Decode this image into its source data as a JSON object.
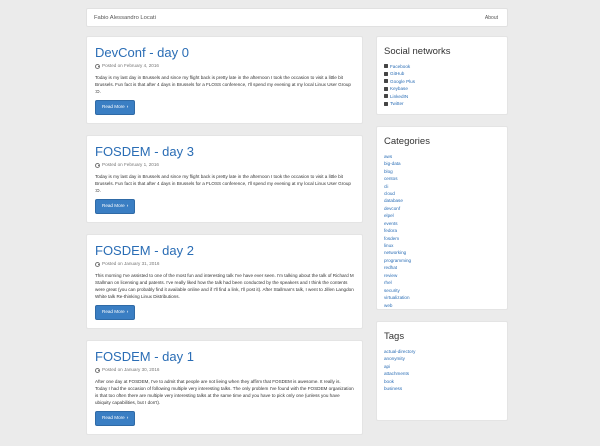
{
  "navbar": {
    "brand": "Fabio Alessandro Locati",
    "about": "About"
  },
  "posts": [
    {
      "title": "DevConf - day 0",
      "date": "Posted on February 4, 2016",
      "body": "Today is my last day in Brussels and since my flight back is pretty late in the afternoon I took the occasion to visit a little bit Brussels. Fun fact is that after 4 days in Brussels for a FLOSS conference, I'll spend my evening at my local Linux User Group :D.",
      "button": "Read More"
    },
    {
      "title": "FOSDEM - day 3",
      "date": "Posted on February 1, 2016",
      "body": "Today is my last day in Brussels and since my flight back is pretty late in the afternoon I took the occasion to visit a little bit Brussels. Fun fact is that after 4 days in Brussels for a FLOSS conference, I'll spend my evening at my local Linux User Group :D.",
      "button": "Read More"
    },
    {
      "title": "FOSDEM - day 2",
      "date": "Posted on January 31, 2016",
      "body": "This morning I've assisted to one of the most fun and interesting talk I've have ever seen. I'm talking about the talk of Richard M Stallman on licensing and patents. I've really liked how the talk had been conducted by the speakers and I think the contents were great (you can probably find it available online and if I'll find a link, I'll post it). After Stallman's talk, I went to Jillen Langdon White talk Re-thinking Linux Distributions.",
      "button": "Read More"
    },
    {
      "title": "FOSDEM - day 1",
      "date": "Posted on January 30, 2016",
      "body": "After one day at FOSDEM, I've to admit that people are not lieing when they affirm that FOSDEM is awesome. It really is. Today I had the occasion of following multiple very interesting talks. The only problem I've found with the FOSDEM organization is that too often there are multiple very interesting talks at the same time and you have to pick only one (unless you have ubiquity capabilities, but I don't).",
      "button": "Read More"
    }
  ],
  "sidebar": {
    "social": {
      "title": "Social networks",
      "items": [
        "Facebook",
        "GitHub",
        "Google Plus",
        "Keybase",
        "LinkedIN",
        "Twitter"
      ]
    },
    "categories": {
      "title": "Categories",
      "items": [
        "aws",
        "big-data",
        "blog",
        "centos",
        "cli",
        "cloud",
        "database",
        "devconf",
        "elpel",
        "events",
        "fedora",
        "fosdem",
        "linux",
        "networking",
        "programming",
        "redhat",
        "review",
        "rhel",
        "security",
        "virtualization",
        "web"
      ]
    },
    "tags": {
      "title": "Tags",
      "items": [
        "actual-directory",
        "anonymity",
        "api",
        "attachments",
        "book",
        "business"
      ]
    }
  }
}
